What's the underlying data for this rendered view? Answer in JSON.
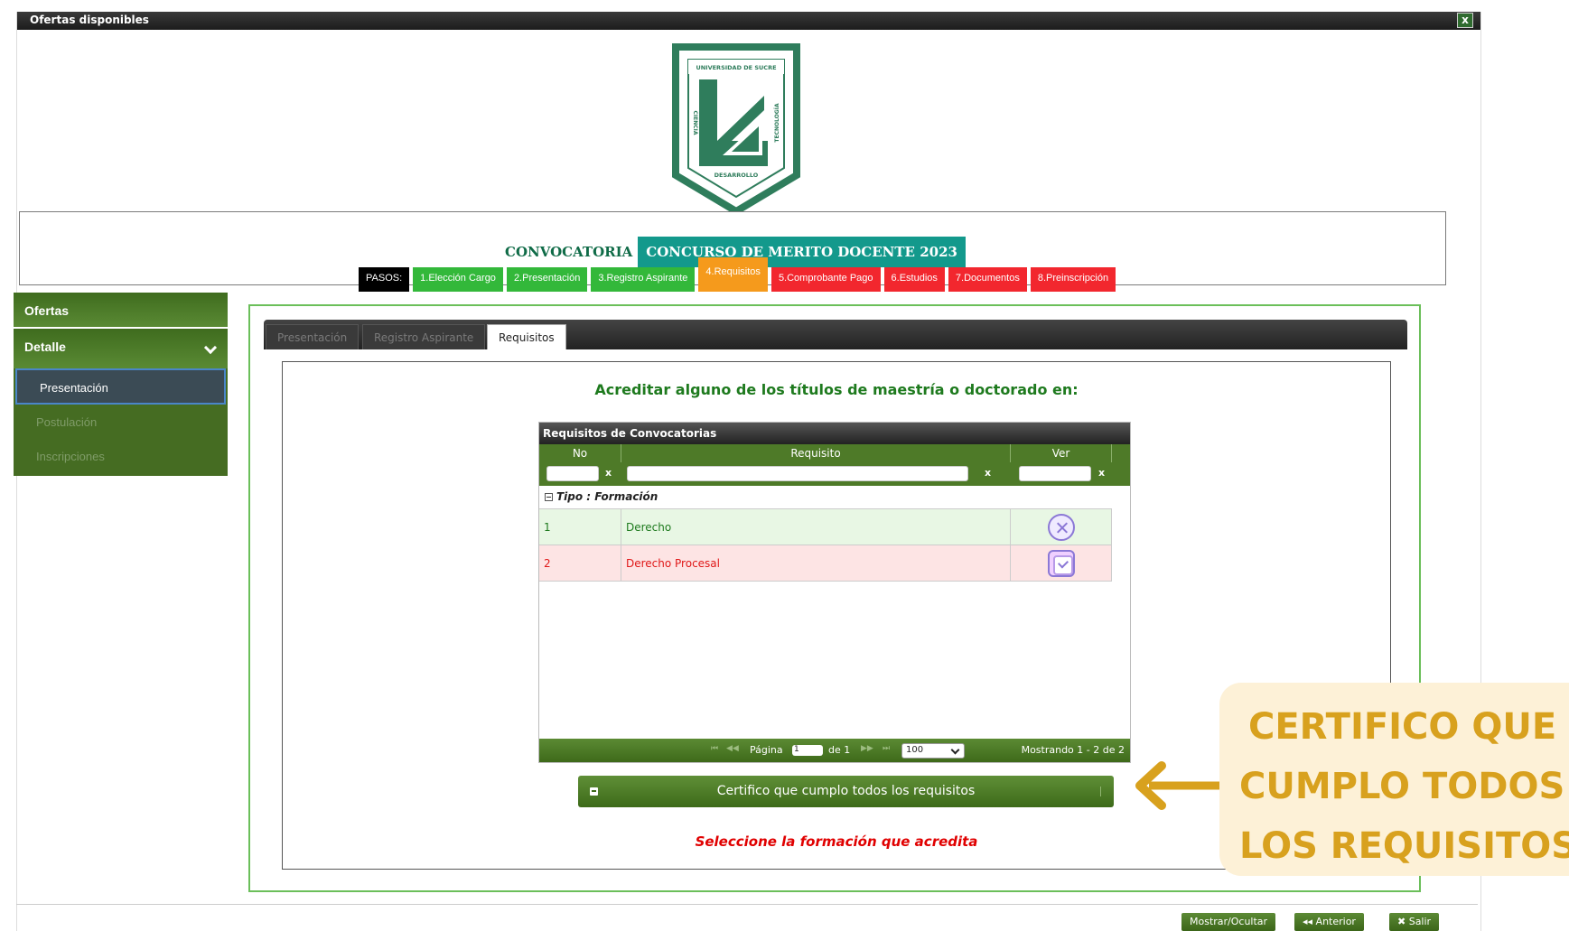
{
  "window": {
    "title": "Ofertas disponibles",
    "close_label": "x"
  },
  "logo": {
    "top_text": "UNIVERSIDAD DE SUCRE",
    "left_text": "CIENCIA",
    "right_text": "TECNOLOGÍA",
    "bottom_text": "DESARROLLO"
  },
  "convocatoria": {
    "label": "CONVOCATORIA",
    "name": "CONCURSO DE MERITO DOCENTE 2023"
  },
  "steps": [
    {
      "label": "PASOS:"
    },
    {
      "label": "1.Elección Cargo"
    },
    {
      "label": "2.Presentación"
    },
    {
      "label": "3.Registro Aspirante"
    },
    {
      "label": "4.Requisitos"
    },
    {
      "label": "5.Comprobante Pago"
    },
    {
      "label": "6.Estudios"
    },
    {
      "label": "7.Documentos"
    },
    {
      "label": "8.Preinscripción"
    }
  ],
  "sidebar": {
    "ofertas": "Ofertas",
    "detalle": "Detalle",
    "items": [
      {
        "label": "Presentación"
      },
      {
        "label": "Postulación"
      },
      {
        "label": "Inscripciones"
      }
    ]
  },
  "tabs": [
    {
      "label": "Presentación"
    },
    {
      "label": "Registro Aspirante"
    },
    {
      "label": "Requisitos"
    }
  ],
  "content": {
    "heading": "Acreditar alguno de los títulos de maestría o doctorado en:"
  },
  "grid": {
    "title": "Requisitos de Convocatorias",
    "columns": [
      "No",
      "Requisito",
      "Ver"
    ],
    "filter_clear": "x",
    "group_label": "Tipo : Formación",
    "group_toggle": "−",
    "rows": [
      {
        "no": "1",
        "requisito": "Derecho"
      },
      {
        "no": "2",
        "requisito": "Derecho Procesal"
      }
    ],
    "pager": {
      "first": "⏮",
      "prev": "◀◀",
      "page_label": "Página",
      "page_value": "1",
      "of_label": "de 1",
      "next": "▶▶",
      "last": "⏭",
      "page_size": "100",
      "info": "Mostrando 1 - 2 de 2"
    }
  },
  "certify_button": "Certifico que cumplo todos los requisitos",
  "warning": "Seleccione la formación que acredita",
  "bottom_buttons": {
    "toggle": "Mostrar/Ocultar",
    "previous": "◂◂ Anterior",
    "exit": "✖ Salir"
  },
  "annotation": {
    "line1": "CERTIFICO QUE",
    "line2": "CUMPLO TODOS",
    "line3": "LOS REQUISITOS",
    "color": "#d8a11e"
  }
}
